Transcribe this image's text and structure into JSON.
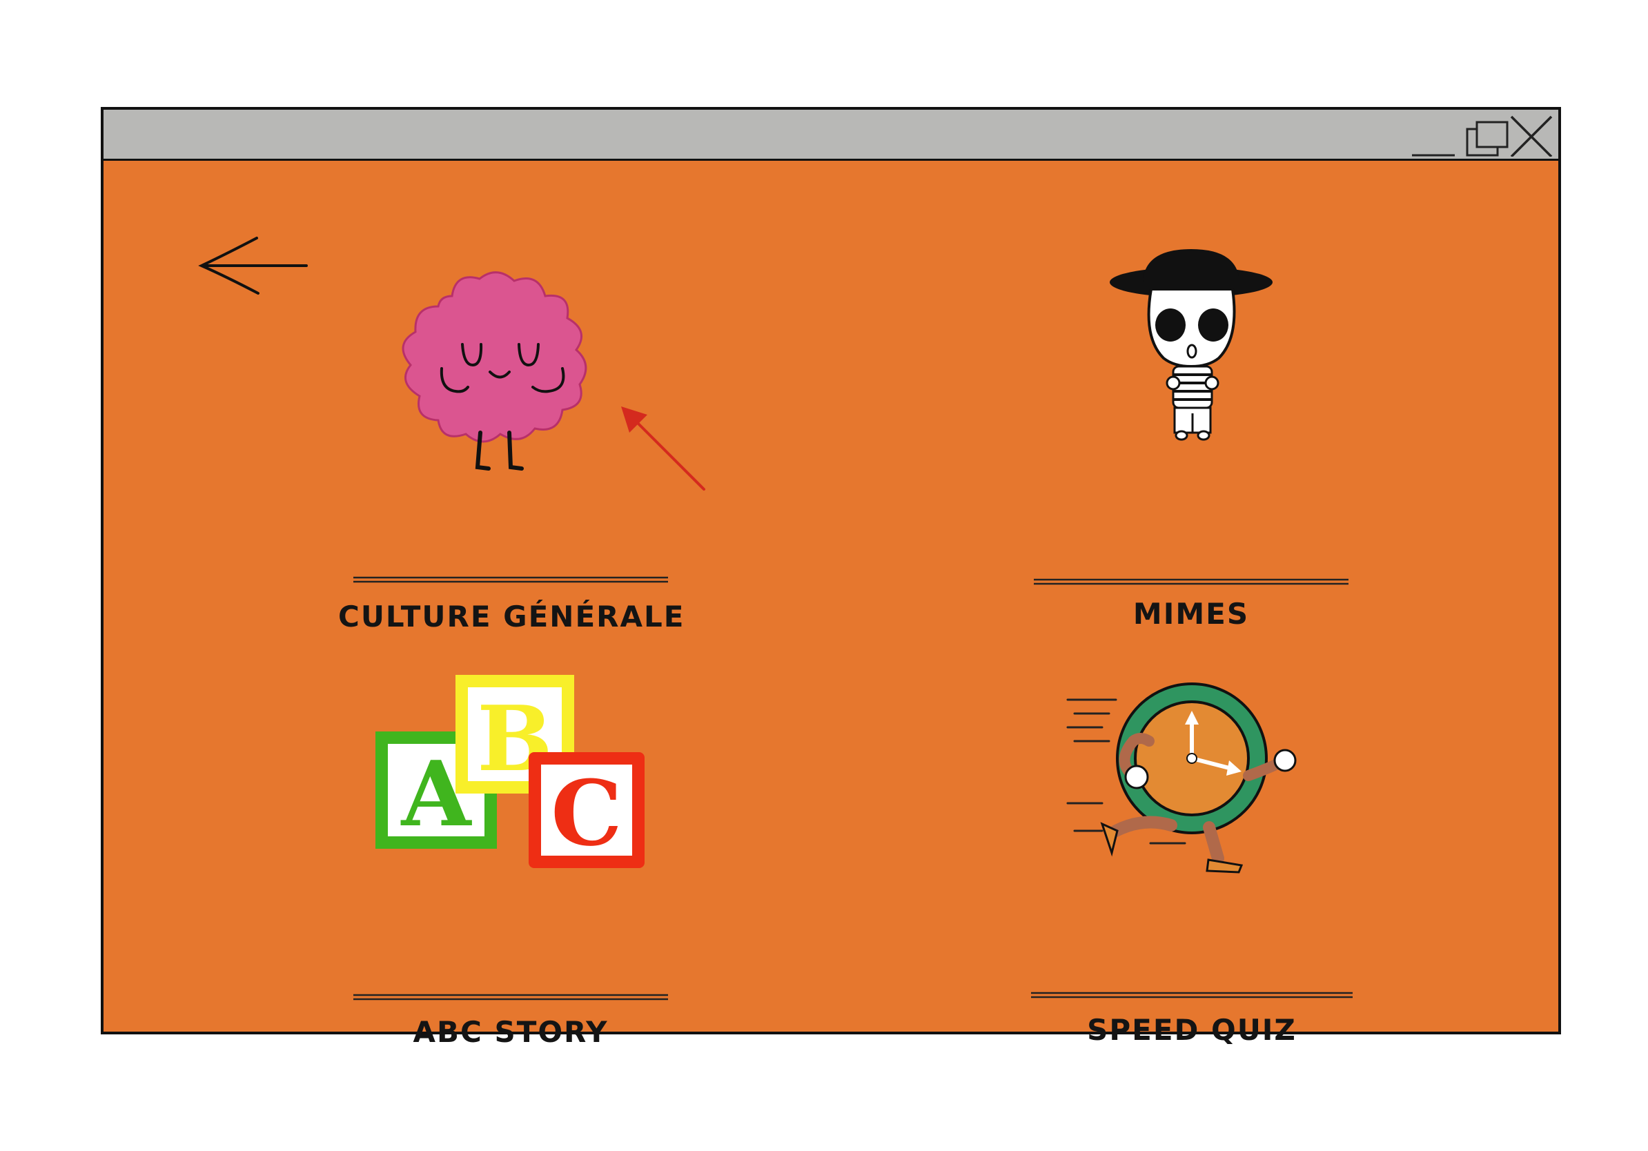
{
  "window": {
    "background": "#E6772E",
    "titlebar_color": "#B8B8B6",
    "controls": [
      "minimize-icon",
      "restore-icon",
      "close-icon"
    ]
  },
  "navigation": {
    "back_icon": "left-arrow-icon"
  },
  "categories": [
    {
      "label": "CULTURE GÉNÉRALE",
      "icon": "brain-character-icon"
    },
    {
      "label": "MIMES",
      "icon": "mime-character-icon"
    },
    {
      "label": "ABC STORY",
      "icon": "abc-blocks-icon"
    },
    {
      "label": "SPEED QUIZ",
      "icon": "running-clock-icon"
    }
  ],
  "annotation": {
    "icon": "red-pointer-arrow-icon",
    "color": "#D42A1E"
  }
}
